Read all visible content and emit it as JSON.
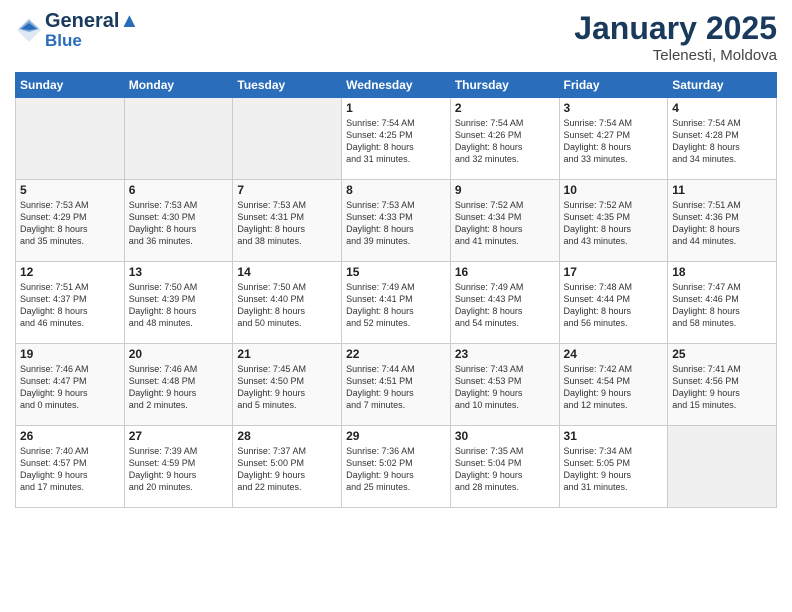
{
  "logo": {
    "line1": "General",
    "line2": "Blue"
  },
  "title": "January 2025",
  "subtitle": "Telenesti, Moldova",
  "weekdays": [
    "Sunday",
    "Monday",
    "Tuesday",
    "Wednesday",
    "Thursday",
    "Friday",
    "Saturday"
  ],
  "weeks": [
    [
      {
        "day": "",
        "text": ""
      },
      {
        "day": "",
        "text": ""
      },
      {
        "day": "",
        "text": ""
      },
      {
        "day": "1",
        "text": "Sunrise: 7:54 AM\nSunset: 4:25 PM\nDaylight: 8 hours\nand 31 minutes."
      },
      {
        "day": "2",
        "text": "Sunrise: 7:54 AM\nSunset: 4:26 PM\nDaylight: 8 hours\nand 32 minutes."
      },
      {
        "day": "3",
        "text": "Sunrise: 7:54 AM\nSunset: 4:27 PM\nDaylight: 8 hours\nand 33 minutes."
      },
      {
        "day": "4",
        "text": "Sunrise: 7:54 AM\nSunset: 4:28 PM\nDaylight: 8 hours\nand 34 minutes."
      }
    ],
    [
      {
        "day": "5",
        "text": "Sunrise: 7:53 AM\nSunset: 4:29 PM\nDaylight: 8 hours\nand 35 minutes."
      },
      {
        "day": "6",
        "text": "Sunrise: 7:53 AM\nSunset: 4:30 PM\nDaylight: 8 hours\nand 36 minutes."
      },
      {
        "day": "7",
        "text": "Sunrise: 7:53 AM\nSunset: 4:31 PM\nDaylight: 8 hours\nand 38 minutes."
      },
      {
        "day": "8",
        "text": "Sunrise: 7:53 AM\nSunset: 4:33 PM\nDaylight: 8 hours\nand 39 minutes."
      },
      {
        "day": "9",
        "text": "Sunrise: 7:52 AM\nSunset: 4:34 PM\nDaylight: 8 hours\nand 41 minutes."
      },
      {
        "day": "10",
        "text": "Sunrise: 7:52 AM\nSunset: 4:35 PM\nDaylight: 8 hours\nand 43 minutes."
      },
      {
        "day": "11",
        "text": "Sunrise: 7:51 AM\nSunset: 4:36 PM\nDaylight: 8 hours\nand 44 minutes."
      }
    ],
    [
      {
        "day": "12",
        "text": "Sunrise: 7:51 AM\nSunset: 4:37 PM\nDaylight: 8 hours\nand 46 minutes."
      },
      {
        "day": "13",
        "text": "Sunrise: 7:50 AM\nSunset: 4:39 PM\nDaylight: 8 hours\nand 48 minutes."
      },
      {
        "day": "14",
        "text": "Sunrise: 7:50 AM\nSunset: 4:40 PM\nDaylight: 8 hours\nand 50 minutes."
      },
      {
        "day": "15",
        "text": "Sunrise: 7:49 AM\nSunset: 4:41 PM\nDaylight: 8 hours\nand 52 minutes."
      },
      {
        "day": "16",
        "text": "Sunrise: 7:49 AM\nSunset: 4:43 PM\nDaylight: 8 hours\nand 54 minutes."
      },
      {
        "day": "17",
        "text": "Sunrise: 7:48 AM\nSunset: 4:44 PM\nDaylight: 8 hours\nand 56 minutes."
      },
      {
        "day": "18",
        "text": "Sunrise: 7:47 AM\nSunset: 4:46 PM\nDaylight: 8 hours\nand 58 minutes."
      }
    ],
    [
      {
        "day": "19",
        "text": "Sunrise: 7:46 AM\nSunset: 4:47 PM\nDaylight: 9 hours\nand 0 minutes."
      },
      {
        "day": "20",
        "text": "Sunrise: 7:46 AM\nSunset: 4:48 PM\nDaylight: 9 hours\nand 2 minutes."
      },
      {
        "day": "21",
        "text": "Sunrise: 7:45 AM\nSunset: 4:50 PM\nDaylight: 9 hours\nand 5 minutes."
      },
      {
        "day": "22",
        "text": "Sunrise: 7:44 AM\nSunset: 4:51 PM\nDaylight: 9 hours\nand 7 minutes."
      },
      {
        "day": "23",
        "text": "Sunrise: 7:43 AM\nSunset: 4:53 PM\nDaylight: 9 hours\nand 10 minutes."
      },
      {
        "day": "24",
        "text": "Sunrise: 7:42 AM\nSunset: 4:54 PM\nDaylight: 9 hours\nand 12 minutes."
      },
      {
        "day": "25",
        "text": "Sunrise: 7:41 AM\nSunset: 4:56 PM\nDaylight: 9 hours\nand 15 minutes."
      }
    ],
    [
      {
        "day": "26",
        "text": "Sunrise: 7:40 AM\nSunset: 4:57 PM\nDaylight: 9 hours\nand 17 minutes."
      },
      {
        "day": "27",
        "text": "Sunrise: 7:39 AM\nSunset: 4:59 PM\nDaylight: 9 hours\nand 20 minutes."
      },
      {
        "day": "28",
        "text": "Sunrise: 7:37 AM\nSunset: 5:00 PM\nDaylight: 9 hours\nand 22 minutes."
      },
      {
        "day": "29",
        "text": "Sunrise: 7:36 AM\nSunset: 5:02 PM\nDaylight: 9 hours\nand 25 minutes."
      },
      {
        "day": "30",
        "text": "Sunrise: 7:35 AM\nSunset: 5:04 PM\nDaylight: 9 hours\nand 28 minutes."
      },
      {
        "day": "31",
        "text": "Sunrise: 7:34 AM\nSunset: 5:05 PM\nDaylight: 9 hours\nand 31 minutes."
      },
      {
        "day": "",
        "text": ""
      }
    ]
  ]
}
